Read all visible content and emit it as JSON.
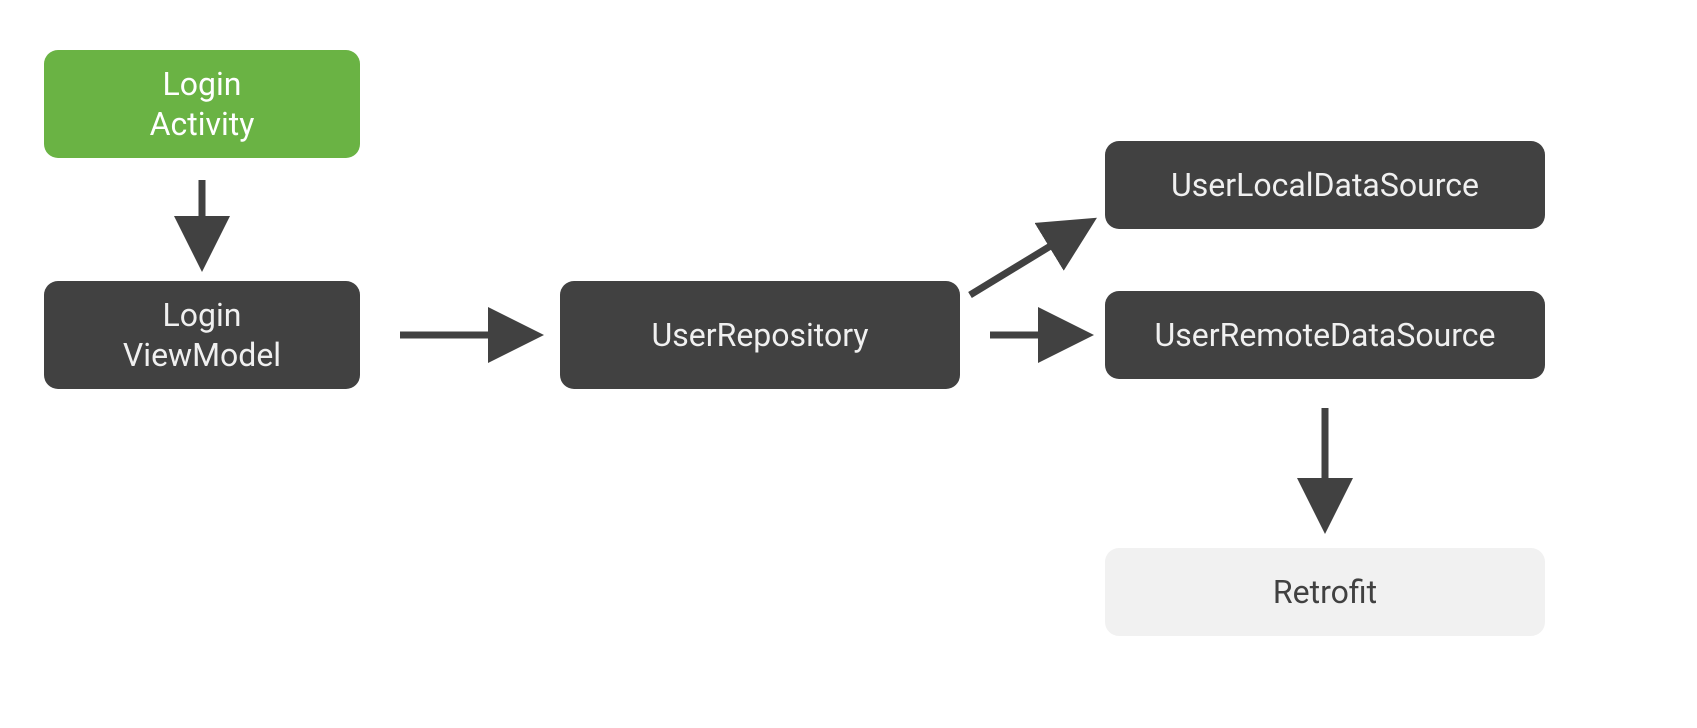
{
  "nodes": {
    "login_activity": {
      "line1": "Login",
      "line2": "Activity"
    },
    "login_viewmodel": {
      "line1": "Login",
      "line2": "ViewModel"
    },
    "user_repository": {
      "label": "UserRepository"
    },
    "user_local_ds": {
      "label": "UserLocalDataSource"
    },
    "user_remote_ds": {
      "label": "UserRemoteDataSource"
    },
    "retrofit": {
      "label": "Retrofit"
    }
  },
  "colors": {
    "green": "#6ab344",
    "dark": "#414141",
    "light": "#f1f1f1",
    "arrow": "#414141"
  }
}
